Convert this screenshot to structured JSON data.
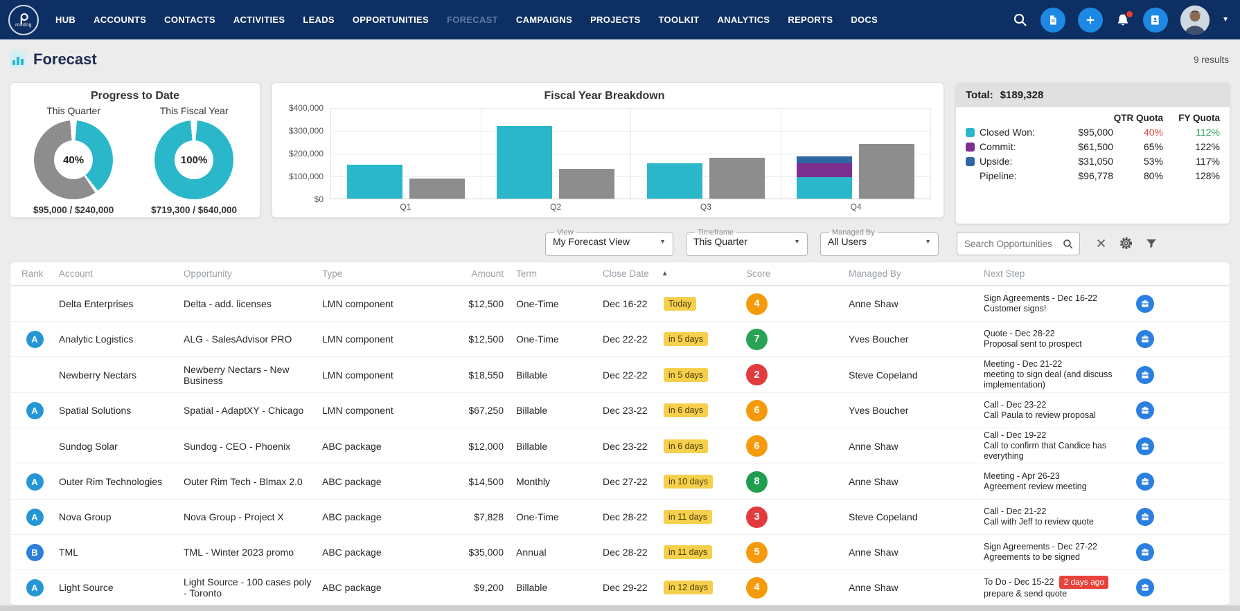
{
  "colors": {
    "navy": "#0d2f63",
    "teal": "#2ab7c9",
    "gray": "#8d8d8d",
    "purple": "#7b2f8e",
    "steel_blue": "#2f66a3",
    "accent_blue": "#1e88e5"
  },
  "nav": {
    "brand": "rolidog",
    "items": [
      {
        "label": "HUB"
      },
      {
        "label": "ACCOUNTS"
      },
      {
        "label": "CONTACTS"
      },
      {
        "label": "ACTIVITIES"
      },
      {
        "label": "LEADS"
      },
      {
        "label": "OPPORTUNITIES"
      },
      {
        "label": "FORECAST",
        "active": true
      },
      {
        "label": "CAMPAIGNS"
      },
      {
        "label": "PROJECTS"
      },
      {
        "label": "TOOLKIT"
      },
      {
        "label": "ANALYTICS"
      },
      {
        "label": "REPORTS"
      },
      {
        "label": "DOCS"
      }
    ]
  },
  "header": {
    "title": "Forecast",
    "results_count": "9 results"
  },
  "progress_card": {
    "title": "Progress to Date",
    "donuts": [
      {
        "label": "This Quarter",
        "percent": 40,
        "percent_label": "40%",
        "amount": "$95,000 / $240,000"
      },
      {
        "label": "This Fiscal Year",
        "percent": 100,
        "percent_label": "100%",
        "amount": "$719,300 / $640,000"
      }
    ]
  },
  "chart_data": {
    "type": "bar",
    "title": "Fiscal Year Breakdown",
    "categories": [
      "Q1",
      "Q2",
      "Q3",
      "Q4"
    ],
    "ylim": [
      0,
      400000
    ],
    "yticks": [
      0,
      100000,
      200000,
      300000,
      400000
    ],
    "ytick_labels": [
      "$0",
      "$100,000",
      "$200,000",
      "$300,000",
      "$400,000"
    ],
    "comparison_name": "Quota",
    "comparison_color": "#8d8d8d",
    "groups": [
      {
        "category": "Q1",
        "stacked": [
          {
            "name": "Closed Won",
            "value": 150000,
            "color": "#2ab7c9"
          }
        ],
        "comparison": 90000
      },
      {
        "category": "Q2",
        "stacked": [
          {
            "name": "Closed Won",
            "value": 320000,
            "color": "#2ab7c9"
          }
        ],
        "comparison": 130000
      },
      {
        "category": "Q3",
        "stacked": [
          {
            "name": "Closed Won",
            "value": 154300,
            "color": "#2ab7c9"
          }
        ],
        "comparison": 180000
      },
      {
        "category": "Q4",
        "stacked": [
          {
            "name": "Closed Won",
            "value": 95000,
            "color": "#2ab7c9"
          },
          {
            "name": "Commit",
            "value": 61500,
            "color": "#7b2f8e"
          },
          {
            "name": "Upside",
            "value": 31050,
            "color": "#2f66a3"
          }
        ],
        "comparison": 240000
      }
    ]
  },
  "totals_card": {
    "total_label": "Total:",
    "total_value": "$189,328",
    "col_headers": [
      "QTR Quota",
      "FY Quota"
    ],
    "rows": [
      {
        "swatch": "#2ab7c9",
        "label": "Closed Won:",
        "amount": "$95,000",
        "qtr": "40%",
        "qtr_color": "#e04b3b",
        "fy": "112%",
        "fy_color": "#27a35a"
      },
      {
        "swatch": "#7b2f8e",
        "label": "Commit:",
        "amount": "$61,500",
        "qtr": "65%",
        "fy": "122%"
      },
      {
        "swatch": "#2f66a3",
        "label": "Upside:",
        "amount": "$31,050",
        "qtr": "53%",
        "fy": "117%"
      },
      {
        "swatch": null,
        "label": "Pipeline:",
        "amount": "$96,778",
        "qtr": "80%",
        "fy": "128%"
      }
    ]
  },
  "filters": {
    "view_label": "View",
    "view_value": "My Forecast View",
    "timeframe_label": "Timeframe",
    "timeframe_value": "This Quarter",
    "managed_by_label": "Managed By",
    "managed_by_value": "All Users",
    "search_placeholder": "Search Opportunities"
  },
  "table": {
    "columns": [
      "Rank",
      "Account",
      "Opportunity",
      "Type",
      "Amount",
      "Term",
      "Close Date",
      "Score",
      "Managed By",
      "Next Step"
    ],
    "sort_column": "Close Date",
    "rows": [
      {
        "rank": "",
        "account": "Delta Enterprises",
        "opportunity": "Delta - add. licenses",
        "type": "LMN component",
        "amount": "$12,500",
        "term": "One-Time",
        "close_date": "Dec 16-22",
        "due": "Today",
        "score": "4",
        "score_color": "#f59b0b",
        "managed_by": "Anne Shaw",
        "next1": "Sign Agreements - Dec 16-22",
        "next2": "Customer signs!"
      },
      {
        "rank": "A",
        "rank_color": "#2596d5",
        "account": "Analytic Logistics",
        "opportunity": "ALG - SalesAdvisor PRO",
        "type": "LMN component",
        "amount": "$12,500",
        "term": "One-Time",
        "close_date": "Dec 22-22",
        "due": "in 5 days",
        "score": "7",
        "score_color": "#2aa256",
        "managed_by": "Yves Boucher",
        "next1": "Quote - Dec 28-22",
        "next2": "Proposal sent to prospect"
      },
      {
        "rank": "",
        "account": "Newberry Nectars",
        "opportunity": "Newberry Nectars - New Business",
        "type": "LMN component",
        "amount": "$18,550",
        "term": "Billable",
        "close_date": "Dec 22-22",
        "due": "in 5 days",
        "score": "2",
        "score_color": "#e23b3e",
        "managed_by": "Steve Copeland",
        "next1": "Meeting - Dec 21-22",
        "next2": "meeting to sign deal (and discuss implementation)"
      },
      {
        "rank": "A",
        "rank_color": "#2596d5",
        "account": "Spatial Solutions",
        "opportunity": "Spatial - AdaptXY - Chicago",
        "type": "LMN component",
        "amount": "$67,250",
        "term": "Billable",
        "close_date": "Dec 23-22",
        "due": "in 6 days",
        "score": "6",
        "score_color": "#f59b0b",
        "managed_by": "Yves Boucher",
        "next1": "Call - Dec 23-22",
        "next2": "Call Paula to review proposal"
      },
      {
        "rank": "",
        "account": "Sundog Solar",
        "opportunity": "Sundog - CEO - Phoenix",
        "type": "ABC package",
        "amount": "$12,000",
        "term": "Billable",
        "close_date": "Dec 23-22",
        "due": "in 6 days",
        "score": "6",
        "score_color": "#f59b0b",
        "managed_by": "Anne Shaw",
        "next1": "Call - Dec 19-22",
        "next2": "Call to confirm that Candice has everything"
      },
      {
        "rank": "A",
        "rank_color": "#2596d5",
        "account": "Outer Rim Technologies",
        "opportunity": "Outer Rim Tech - Blmax 2.0",
        "type": "ABC package",
        "amount": "$14,500",
        "term": "Monthly",
        "close_date": "Dec 27-22",
        "due": "in 10 days",
        "score": "8",
        "score_color": "#1f9e4e",
        "managed_by": "Anne Shaw",
        "next1": "Meeting - Apr 26-23",
        "next2": "Agreement review meeting"
      },
      {
        "rank": "A",
        "rank_color": "#2596d5",
        "account": "Nova Group",
        "opportunity": "Nova Group - Project X",
        "type": "ABC package",
        "amount": "$7,828",
        "term": "One-Time",
        "close_date": "Dec 28-22",
        "due": "in 11 days",
        "score": "3",
        "score_color": "#e23b3e",
        "managed_by": "Steve Copeland",
        "next1": "Call - Dec 21-22",
        "next2": "Call with Jeff to review quote"
      },
      {
        "rank": "B",
        "rank_color": "#2d7fd9",
        "account": "TML",
        "opportunity": "TML - Winter 2023 promo",
        "type": "ABC package",
        "amount": "$35,000",
        "term": "Annual",
        "close_date": "Dec 28-22",
        "due": "in 11 days",
        "score": "5",
        "score_color": "#f59b0b",
        "managed_by": "Anne Shaw",
        "next1": "Sign Agreements - Dec 27-22",
        "next2": "Agreements to be signed"
      },
      {
        "rank": "A",
        "rank_color": "#2596d5",
        "account": "Light Source",
        "opportunity": "Light Source - 100 cases poly - Toronto",
        "type": "ABC package",
        "amount": "$9,200",
        "term": "Billable",
        "close_date": "Dec 29-22",
        "due": "in 12 days",
        "score": "4",
        "score_color": "#f59b0b",
        "managed_by": "Anne Shaw",
        "next1": "To Do - Dec 15-22",
        "overdue": "2 days ago",
        "next2": "prepare & send quote"
      }
    ]
  }
}
